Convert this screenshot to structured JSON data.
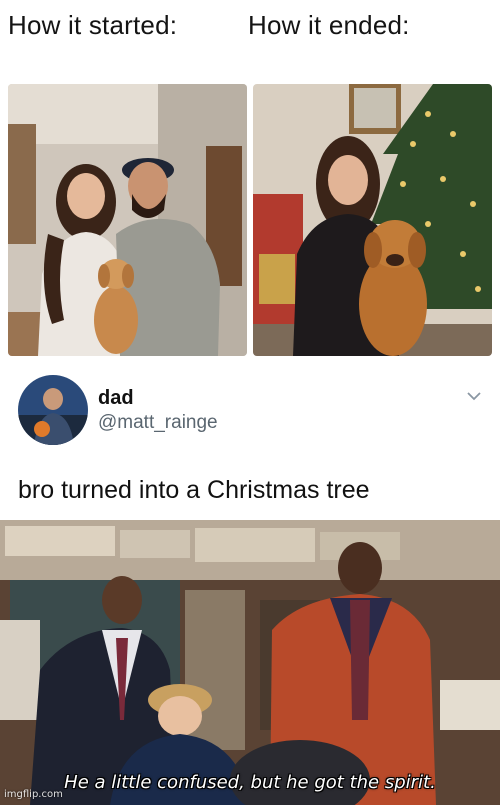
{
  "captions": {
    "left": "How it started:",
    "right": "How it ended:"
  },
  "tweet": {
    "display_name": "dad",
    "handle": "@matt_rainge",
    "text": "bro turned into a Christmas tree"
  },
  "meme": {
    "subtitle": "He a little confused, but he got the spirit.",
    "watermark": "imgflip.com"
  },
  "icons": {
    "menu": "chevron-down-icon"
  }
}
